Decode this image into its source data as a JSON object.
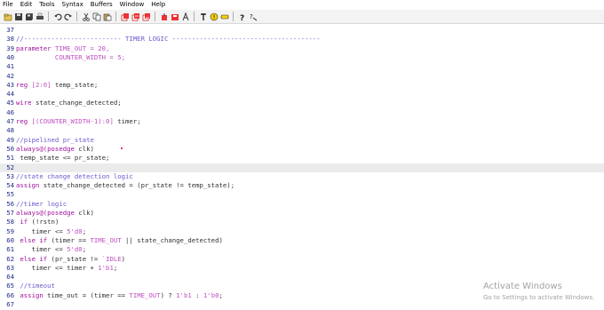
{
  "menu": [
    "File",
    "Edit",
    "Tools",
    "Syntax",
    "Buffers",
    "Window",
    "Help"
  ],
  "toolbar_icons": [
    "open-file-icon",
    "save-icon",
    "save-all-icon",
    "print-icon",
    "sep",
    "undo-icon",
    "redo-icon",
    "sep",
    "cut-icon",
    "copy-icon",
    "paste-icon",
    "sep",
    "find-icon",
    "find-next-icon",
    "find-prev-icon",
    "sep",
    "load-session-icon",
    "save-session-icon",
    "run-script-icon",
    "sep",
    "make-icon",
    "shell-icon",
    "tags-icon",
    "sep",
    "help-icon",
    "find-help-icon"
  ],
  "editor": {
    "current_line": "52",
    "lines": [
      {
        "num": "37",
        "tokens": []
      },
      {
        "num": "38",
        "tokens": [
          {
            "t": "//------------------------- TIMER LOGIC --------------------------------------",
            "c": "comment"
          }
        ]
      },
      {
        "num": "39",
        "tokens": [
          {
            "t": "parameter",
            "c": "kw"
          },
          {
            "t": " TIME_OUT = 20,",
            "c": "num"
          }
        ]
      },
      {
        "num": "40",
        "tokens": [
          {
            "t": "          COUNTER_WIDTH = 5;",
            "c": "num"
          }
        ]
      },
      {
        "num": "41",
        "tokens": []
      },
      {
        "num": "42",
        "tokens": []
      },
      {
        "num": "43",
        "tokens": [
          {
            "t": "reg",
            "c": "kw"
          },
          {
            "t": " [2:0]",
            "c": "num"
          },
          {
            "t": " temp_state;",
            "c": "ident"
          }
        ]
      },
      {
        "num": "44",
        "tokens": []
      },
      {
        "num": "45",
        "tokens": [
          {
            "t": "wire",
            "c": "kw"
          },
          {
            "t": " state_change_detected;",
            "c": "ident"
          }
        ]
      },
      {
        "num": "46",
        "tokens": []
      },
      {
        "num": "47",
        "tokens": [
          {
            "t": "reg",
            "c": "kw"
          },
          {
            "t": " [(COUNTER_WIDTH-1):0]",
            "c": "num"
          },
          {
            "t": " timer;",
            "c": "ident"
          }
        ]
      },
      {
        "num": "48",
        "tokens": []
      },
      {
        "num": "49",
        "tokens": [
          {
            "t": "//pipelined pr_state",
            "c": "comment"
          }
        ]
      },
      {
        "num": "50",
        "tokens": [
          {
            "t": "always@(posedge",
            "c": "kw"
          },
          {
            "t": " clk)",
            "c": "ident"
          }
        ]
      },
      {
        "num": "51",
        "tokens": [
          {
            "t": " temp_state <= pr_state;",
            "c": "ident"
          }
        ]
      },
      {
        "num": "52",
        "tokens": []
      },
      {
        "num": "53",
        "tokens": [
          {
            "t": "//state change detection logic",
            "c": "comment"
          }
        ]
      },
      {
        "num": "54",
        "tokens": [
          {
            "t": "assign",
            "c": "kw"
          },
          {
            "t": " state_change_detected = (pr_state != temp_state);",
            "c": "ident"
          }
        ]
      },
      {
        "num": "55",
        "tokens": []
      },
      {
        "num": "56",
        "tokens": [
          {
            "t": "//timer logic",
            "c": "comment"
          }
        ]
      },
      {
        "num": "57",
        "tokens": [
          {
            "t": "always@(posedge",
            "c": "kw"
          },
          {
            "t": " clk)",
            "c": "ident"
          }
        ]
      },
      {
        "num": "58",
        "tokens": [
          {
            "t": " if",
            "c": "kw"
          },
          {
            "t": " (!rstn)",
            "c": "ident"
          }
        ]
      },
      {
        "num": "59",
        "tokens": [
          {
            "t": "    timer <= ",
            "c": "ident"
          },
          {
            "t": "5'd0",
            "c": "num"
          },
          {
            "t": ";",
            "c": "ident"
          }
        ]
      },
      {
        "num": "60",
        "tokens": [
          {
            "t": " else if",
            "c": "kw"
          },
          {
            "t": " (timer == ",
            "c": "ident"
          },
          {
            "t": "TIME_OUT",
            "c": "num"
          },
          {
            "t": " || state_change_detected)",
            "c": "ident"
          }
        ]
      },
      {
        "num": "61",
        "tokens": [
          {
            "t": "    timer <= ",
            "c": "ident"
          },
          {
            "t": "5'd0",
            "c": "num"
          },
          {
            "t": ";",
            "c": "ident"
          }
        ]
      },
      {
        "num": "62",
        "tokens": [
          {
            "t": " else if",
            "c": "kw"
          },
          {
            "t": " (pr_state != ",
            "c": "ident"
          },
          {
            "t": "`IDLE",
            "c": "num"
          },
          {
            "t": ")",
            "c": "ident"
          }
        ]
      },
      {
        "num": "63",
        "tokens": [
          {
            "t": "    timer <= timer + ",
            "c": "ident"
          },
          {
            "t": "1'b1",
            "c": "num"
          },
          {
            "t": ";",
            "c": "ident"
          }
        ]
      },
      {
        "num": "64",
        "tokens": []
      },
      {
        "num": "65",
        "tokens": [
          {
            "t": " //timeout",
            "c": "comment"
          }
        ]
      },
      {
        "num": "66",
        "tokens": [
          {
            "t": " assign",
            "c": "kw"
          },
          {
            "t": " time_out = (timer == ",
            "c": "ident"
          },
          {
            "t": "TIME_OUT",
            "c": "num"
          },
          {
            "t": ") ? ",
            "c": "ident"
          },
          {
            "t": "1'b1",
            "c": "num"
          },
          {
            "t": " : ",
            "c": "ident"
          },
          {
            "t": "1'b0",
            "c": "num"
          },
          {
            "t": ";",
            "c": "ident"
          }
        ]
      },
      {
        "num": "67",
        "tokens": []
      }
    ]
  },
  "watermark": {
    "title": "Activate Windows",
    "subtitle": "Go to Settings to activate Windows."
  },
  "colors": {
    "comment": "#6a5acd",
    "keyword": "#a0119c",
    "number": "#c04fc0",
    "line_number": "#1f2a88"
  }
}
